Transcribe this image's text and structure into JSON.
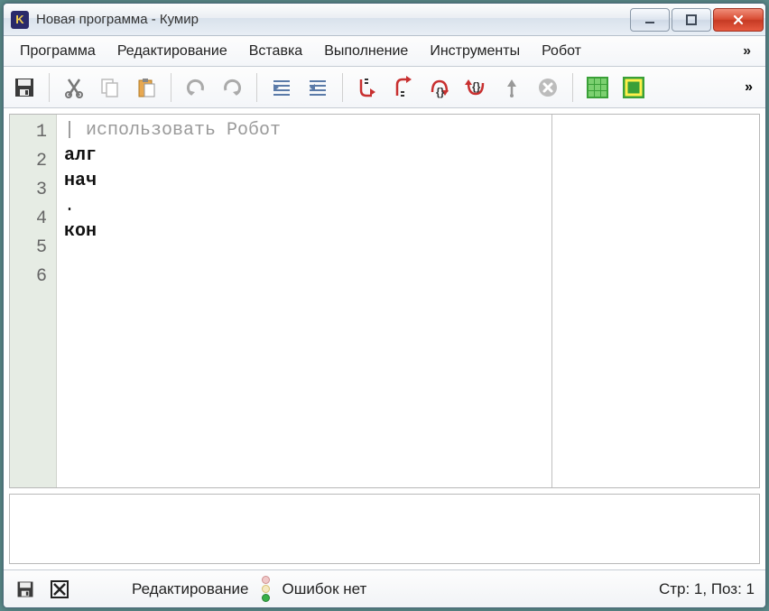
{
  "window": {
    "title": "Новая программа - Кумир",
    "app_icon_letter": "K"
  },
  "menu": {
    "items": [
      "Программа",
      "Редактирование",
      "Вставка",
      "Выполнение",
      "Инструменты",
      "Робот"
    ],
    "more": "»"
  },
  "toolbar": {
    "more": "»"
  },
  "editor": {
    "lines": [
      "1",
      "2",
      "3",
      "4",
      "5",
      "6"
    ],
    "code": [
      {
        "type": "comment",
        "text": "| использовать Робот"
      },
      {
        "type": "kw",
        "text": "алг"
      },
      {
        "type": "kw",
        "text": "нач"
      },
      {
        "type": "plain",
        "text": "."
      },
      {
        "type": "kw",
        "text": "кон"
      },
      {
        "type": "plain",
        "text": ""
      }
    ]
  },
  "status": {
    "mode": "Редактирование",
    "errors": "Ошибок нет",
    "position": "Стр: 1, Поз: 1"
  }
}
